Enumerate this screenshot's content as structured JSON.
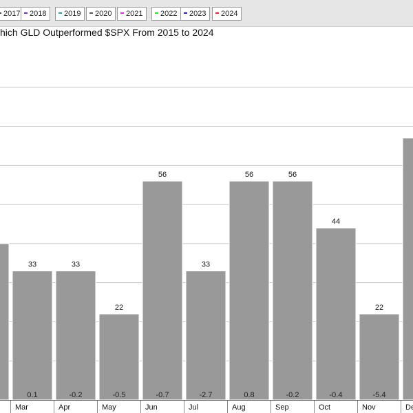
{
  "legend": {
    "items": [
      {
        "label": "2017",
        "color": "#444444"
      },
      {
        "label": "2018",
        "color": "#7a2fb8"
      },
      {
        "label": "2019",
        "color": "#2aa0a8"
      },
      {
        "label": "2020",
        "color": "#555555"
      },
      {
        "label": "2021",
        "color": "#e02fe0"
      },
      {
        "label": "2022",
        "color": "#33dd33"
      },
      {
        "label": "2023",
        "color": "#2222aa"
      },
      {
        "label": "2024",
        "color": "#ee2222"
      }
    ]
  },
  "chart_data": {
    "type": "bar",
    "title": "hich GLD Outperformed $SPX From 2015 to 2024",
    "categories": [
      "",
      "Mar",
      "Apr",
      "May",
      "Jun",
      "Jul",
      "Aug",
      "Sep",
      "Oct",
      "Nov",
      "De"
    ],
    "values": [
      40,
      33,
      33,
      22,
      56,
      33,
      56,
      56,
      44,
      22,
      67
    ],
    "value_labels": [
      "",
      "33",
      "33",
      "22",
      "56",
      "33",
      "56",
      "56",
      "44",
      "22",
      ""
    ],
    "sub_labels": [
      "",
      "0.1",
      "-0.2",
      "-0.5",
      "-0.7",
      "-2.7",
      "0.8",
      "-0.2",
      "-0.4",
      "-5.4",
      ""
    ],
    "ylim": [
      0,
      90
    ],
    "grid": true,
    "bar_color": "#999999",
    "bar_border_color": "#ffffff",
    "grid_color": "#c8c8c8"
  }
}
